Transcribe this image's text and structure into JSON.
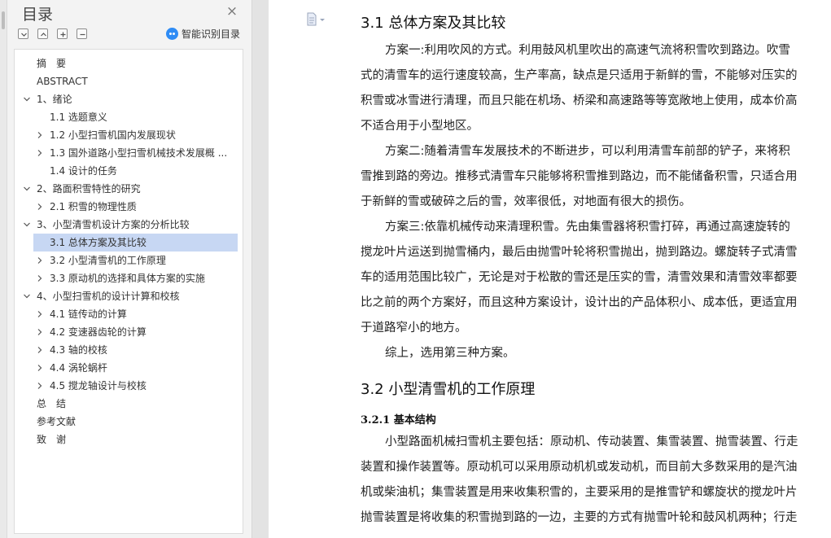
{
  "sidebar": {
    "title": "目录",
    "close_glyph": "×",
    "toolbar": {
      "collapse_icon": "collapse-all-icon",
      "expand_icon": "expand-all-icon",
      "add_icon": "add-heading-icon",
      "remove_icon": "remove-heading-icon"
    },
    "ai_toc_label": "智能识别目录",
    "toc": [
      {
        "label": "摘　要",
        "level": 1,
        "expander": "none",
        "active": false
      },
      {
        "label": "ABSTRACT",
        "level": 1,
        "expander": "none",
        "active": false
      },
      {
        "label": "1、绪论",
        "level": 1,
        "expander": "expanded",
        "active": false
      },
      {
        "label": "1.1  选题意义",
        "level": 2,
        "expander": "none",
        "active": false
      },
      {
        "label": "1.2 小型扫雪机国内发展现状",
        "level": 2,
        "expander": "collapsed",
        "active": false
      },
      {
        "label": "1.3 国外道路小型扫雪机械技术发展概 ...",
        "level": 2,
        "expander": "collapsed",
        "active": false
      },
      {
        "label": "1.4  设计的任务",
        "level": 2,
        "expander": "none",
        "active": false
      },
      {
        "label": "2、路面积雪特性的研究",
        "level": 1,
        "expander": "expanded",
        "active": false
      },
      {
        "label": "2.1  积雪的物理性质",
        "level": 2,
        "expander": "collapsed",
        "active": false
      },
      {
        "label": "3、小型清雪机设计方案的分析比较",
        "level": 1,
        "expander": "expanded",
        "active": false
      },
      {
        "label": "3.1  总体方案及其比较",
        "level": 2,
        "expander": "none",
        "active": true
      },
      {
        "label": "3.2  小型清雪机的工作原理",
        "level": 2,
        "expander": "collapsed",
        "active": false
      },
      {
        "label": "3.3  原动机的选择和具体方案的实施",
        "level": 2,
        "expander": "collapsed",
        "active": false
      },
      {
        "label": "4、小型扫雪机的设计计算和校核",
        "level": 1,
        "expander": "expanded",
        "active": false
      },
      {
        "label": "4.1  链传动的计算",
        "level": 2,
        "expander": "collapsed",
        "active": false
      },
      {
        "label": "4.2  变速器齿轮的计算",
        "level": 2,
        "expander": "collapsed",
        "active": false
      },
      {
        "label": "4.3  轴的校核",
        "level": 2,
        "expander": "collapsed",
        "active": false
      },
      {
        "label": "4.4 涡轮蜗杆",
        "level": 2,
        "expander": "collapsed",
        "active": false
      },
      {
        "label": "4.5 搅龙轴设计与校核",
        "level": 2,
        "expander": "collapsed",
        "active": false
      },
      {
        "label": "总　结",
        "level": 1,
        "expander": "none",
        "active": false
      },
      {
        "label": "参考文献",
        "level": 1,
        "expander": "none",
        "active": false
      },
      {
        "label": "致　谢",
        "level": 1,
        "expander": "none",
        "active": false
      }
    ]
  },
  "document": {
    "heading_31": "3.1  总体方案及其比较",
    "para_1": [
      "方案一:利用吹风的方式。利用鼓风机里吹出的高速气流将积雪吹到路边。吹雪",
      "式的清雪车的运行速度较高，生产率高，缺点是只适用于新鲜的雪，不能够对压实的",
      "积雪或冰雪进行清理，而且只能在机场、桥梁和高速路等等宽敞地上使用，成本价高",
      "不适合用于小型地区。"
    ],
    "para_2": [
      "方案二:随着清雪车发展技术的不断进步，可以利用清雪车前部的铲子，来将积",
      "雪推到路的旁边。推移式清雪车只能够将积雪推到路边，而不能储备积雪，只适合用",
      "于新鲜的雪或破碎之后的雪，效率很低，对地面有很大的损伤。"
    ],
    "para_3": [
      "方案三:依靠机械传动来清理积雪。先由集雪器将积雪打碎，再通过高速旋转的",
      "搅龙叶片运送到抛雪桶内，最后由抛雪叶轮将积雪抛出，抛到路边。螺旋转子式清雪",
      "车的适用范围比较广，无论是对于松散的雪还是压实的雪，清雪效果和清雪效率都要",
      "比之前的两个方案好，而且这种方案设计，设计出的产品体积小、成本低，更适宜用",
      "于道路窄小的地方。"
    ],
    "para_4": [
      "综上，选用第三种方案。"
    ],
    "heading_32": "3.2  小型清雪机的工作原理",
    "heading_321": "3.2.1 基本结构",
    "para_5": [
      "小型路面机械扫雪机主要包括：原动机、传动装置、集雪装置、抛雪装置、行走",
      "装置和操作装置等。原动机可以采用原动机机或发动机，而目前大多数采用的是汽油",
      "机或柴油机；集雪装置是用来收集积雪的，主要采用的是推雪铲和螺旋状的搅龙叶片",
      "抛雪装置是将收集的积雪抛到路的一边，主要的方式有抛雪叶轮和鼓风机两种；行走"
    ]
  }
}
